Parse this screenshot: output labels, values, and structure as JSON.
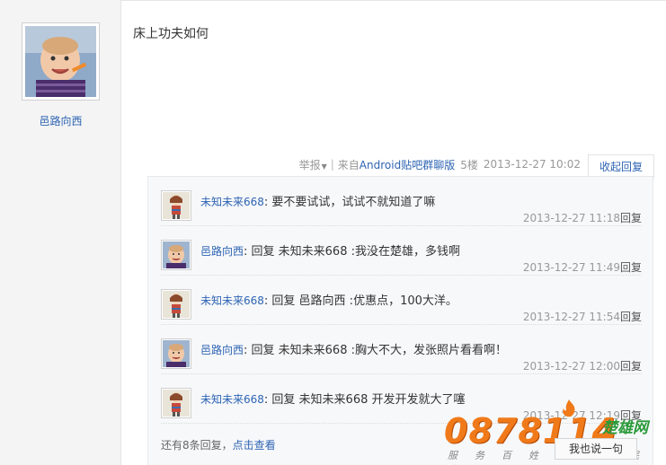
{
  "post": {
    "author": "邑路向西",
    "content": "床上功夫如何",
    "tail": {
      "report": "举报",
      "source": "来自",
      "source_link": "Android贴吧群聊版",
      "floor": "5楼",
      "time": "2013-12-27 10:02",
      "collapse": "收起回复"
    }
  },
  "replies": [
    {
      "user": "未知未来668",
      "text": ": 要不要试试，试试不就知道了嘛",
      "time": "2013-12-27 11:18",
      "reply_label": "回复",
      "avatar": "doll"
    },
    {
      "user": "邑路向西",
      "text": ": 回复 未知未来668 :我没在楚雄，多钱啊",
      "time": "2013-12-27 11:49",
      "reply_label": "回复",
      "avatar": "baby"
    },
    {
      "user": "未知未来668",
      "text": ": 回复 邑路向西 :优惠点，100大洋。",
      "time": "2013-12-27 11:54",
      "reply_label": "回复",
      "avatar": "doll"
    },
    {
      "user": "邑路向西",
      "text": ": 回复 未知未来668 :胸大不大，发张照片看看啊！",
      "time": "2013-12-27 12:00",
      "reply_label": "回复",
      "avatar": "baby"
    },
    {
      "user": "未知未来668",
      "text": ": 回复 未知未来668 开发开发就大了噻",
      "time": "2013-12-27 12:19",
      "reply_label": "回复",
      "avatar": "doll"
    }
  ],
  "more": {
    "count_text": "还有8条回复，",
    "link": "点击查看"
  },
  "say_button": "我也说一句",
  "watermark": {
    "number": "0878114",
    "domain": ".com",
    "brand": "楚雄网",
    "slogan": "服务百姓 关注民生"
  }
}
